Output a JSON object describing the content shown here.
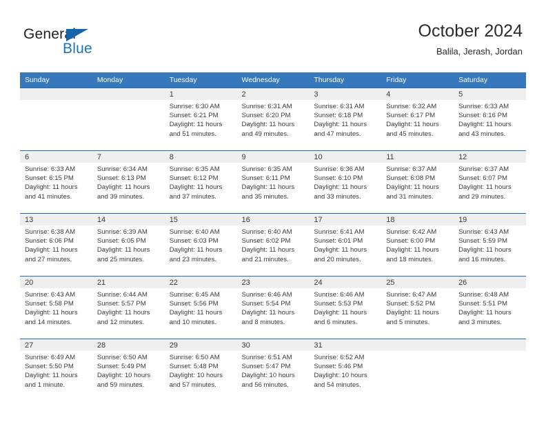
{
  "logo": {
    "word_one": "General",
    "word_two": "Blue",
    "flag_icon": "triangle-flag-icon",
    "brand_blue": "#1a74bd"
  },
  "header": {
    "title": "October 2024",
    "subtitle": "Balila, Jerash, Jordan"
  },
  "theme": {
    "header_blue": "#3778bc",
    "rule_blue": "#1d6cb3",
    "daynum_band": "#efefef",
    "text": "#3a3a3a"
  },
  "calendar": {
    "weekdays": [
      "Sunday",
      "Monday",
      "Tuesday",
      "Wednesday",
      "Thursday",
      "Friday",
      "Saturday"
    ],
    "weeks": [
      [
        {
          "day": "",
          "sunrise": "",
          "sunset": "",
          "daylight_1": "",
          "daylight_2": ""
        },
        {
          "day": "",
          "sunrise": "",
          "sunset": "",
          "daylight_1": "",
          "daylight_2": ""
        },
        {
          "day": "1",
          "sunrise": "Sunrise: 6:30 AM",
          "sunset": "Sunset: 6:21 PM",
          "daylight_1": "Daylight: 11 hours",
          "daylight_2": "and 51 minutes."
        },
        {
          "day": "2",
          "sunrise": "Sunrise: 6:31 AM",
          "sunset": "Sunset: 6:20 PM",
          "daylight_1": "Daylight: 11 hours",
          "daylight_2": "and 49 minutes."
        },
        {
          "day": "3",
          "sunrise": "Sunrise: 6:31 AM",
          "sunset": "Sunset: 6:18 PM",
          "daylight_1": "Daylight: 11 hours",
          "daylight_2": "and 47 minutes."
        },
        {
          "day": "4",
          "sunrise": "Sunrise: 6:32 AM",
          "sunset": "Sunset: 6:17 PM",
          "daylight_1": "Daylight: 11 hours",
          "daylight_2": "and 45 minutes."
        },
        {
          "day": "5",
          "sunrise": "Sunrise: 6:33 AM",
          "sunset": "Sunset: 6:16 PM",
          "daylight_1": "Daylight: 11 hours",
          "daylight_2": "and 43 minutes."
        }
      ],
      [
        {
          "day": "6",
          "sunrise": "Sunrise: 6:33 AM",
          "sunset": "Sunset: 6:15 PM",
          "daylight_1": "Daylight: 11 hours",
          "daylight_2": "and 41 minutes."
        },
        {
          "day": "7",
          "sunrise": "Sunrise: 6:34 AM",
          "sunset": "Sunset: 6:13 PM",
          "daylight_1": "Daylight: 11 hours",
          "daylight_2": "and 39 minutes."
        },
        {
          "day": "8",
          "sunrise": "Sunrise: 6:35 AM",
          "sunset": "Sunset: 6:12 PM",
          "daylight_1": "Daylight: 11 hours",
          "daylight_2": "and 37 minutes."
        },
        {
          "day": "9",
          "sunrise": "Sunrise: 6:35 AM",
          "sunset": "Sunset: 6:11 PM",
          "daylight_1": "Daylight: 11 hours",
          "daylight_2": "and 35 minutes."
        },
        {
          "day": "10",
          "sunrise": "Sunrise: 6:36 AM",
          "sunset": "Sunset: 6:10 PM",
          "daylight_1": "Daylight: 11 hours",
          "daylight_2": "and 33 minutes."
        },
        {
          "day": "11",
          "sunrise": "Sunrise: 6:37 AM",
          "sunset": "Sunset: 6:08 PM",
          "daylight_1": "Daylight: 11 hours",
          "daylight_2": "and 31 minutes."
        },
        {
          "day": "12",
          "sunrise": "Sunrise: 6:37 AM",
          "sunset": "Sunset: 6:07 PM",
          "daylight_1": "Daylight: 11 hours",
          "daylight_2": "and 29 minutes."
        }
      ],
      [
        {
          "day": "13",
          "sunrise": "Sunrise: 6:38 AM",
          "sunset": "Sunset: 6:06 PM",
          "daylight_1": "Daylight: 11 hours",
          "daylight_2": "and 27 minutes."
        },
        {
          "day": "14",
          "sunrise": "Sunrise: 6:39 AM",
          "sunset": "Sunset: 6:05 PM",
          "daylight_1": "Daylight: 11 hours",
          "daylight_2": "and 25 minutes."
        },
        {
          "day": "15",
          "sunrise": "Sunrise: 6:40 AM",
          "sunset": "Sunset: 6:03 PM",
          "daylight_1": "Daylight: 11 hours",
          "daylight_2": "and 23 minutes."
        },
        {
          "day": "16",
          "sunrise": "Sunrise: 6:40 AM",
          "sunset": "Sunset: 6:02 PM",
          "daylight_1": "Daylight: 11 hours",
          "daylight_2": "and 21 minutes."
        },
        {
          "day": "17",
          "sunrise": "Sunrise: 6:41 AM",
          "sunset": "Sunset: 6:01 PM",
          "daylight_1": "Daylight: 11 hours",
          "daylight_2": "and 20 minutes."
        },
        {
          "day": "18",
          "sunrise": "Sunrise: 6:42 AM",
          "sunset": "Sunset: 6:00 PM",
          "daylight_1": "Daylight: 11 hours",
          "daylight_2": "and 18 minutes."
        },
        {
          "day": "19",
          "sunrise": "Sunrise: 6:43 AM",
          "sunset": "Sunset: 5:59 PM",
          "daylight_1": "Daylight: 11 hours",
          "daylight_2": "and 16 minutes."
        }
      ],
      [
        {
          "day": "20",
          "sunrise": "Sunrise: 6:43 AM",
          "sunset": "Sunset: 5:58 PM",
          "daylight_1": "Daylight: 11 hours",
          "daylight_2": "and 14 minutes."
        },
        {
          "day": "21",
          "sunrise": "Sunrise: 6:44 AM",
          "sunset": "Sunset: 5:57 PM",
          "daylight_1": "Daylight: 11 hours",
          "daylight_2": "and 12 minutes."
        },
        {
          "day": "22",
          "sunrise": "Sunrise: 6:45 AM",
          "sunset": "Sunset: 5:56 PM",
          "daylight_1": "Daylight: 11 hours",
          "daylight_2": "and 10 minutes."
        },
        {
          "day": "23",
          "sunrise": "Sunrise: 6:46 AM",
          "sunset": "Sunset: 5:54 PM",
          "daylight_1": "Daylight: 11 hours",
          "daylight_2": "and 8 minutes."
        },
        {
          "day": "24",
          "sunrise": "Sunrise: 6:46 AM",
          "sunset": "Sunset: 5:53 PM",
          "daylight_1": "Daylight: 11 hours",
          "daylight_2": "and 6 minutes."
        },
        {
          "day": "25",
          "sunrise": "Sunrise: 6:47 AM",
          "sunset": "Sunset: 5:52 PM",
          "daylight_1": "Daylight: 11 hours",
          "daylight_2": "and 5 minutes."
        },
        {
          "day": "26",
          "sunrise": "Sunrise: 6:48 AM",
          "sunset": "Sunset: 5:51 PM",
          "daylight_1": "Daylight: 11 hours",
          "daylight_2": "and 3 minutes."
        }
      ],
      [
        {
          "day": "27",
          "sunrise": "Sunrise: 6:49 AM",
          "sunset": "Sunset: 5:50 PM",
          "daylight_1": "Daylight: 11 hours",
          "daylight_2": "and 1 minute."
        },
        {
          "day": "28",
          "sunrise": "Sunrise: 6:50 AM",
          "sunset": "Sunset: 5:49 PM",
          "daylight_1": "Daylight: 10 hours",
          "daylight_2": "and 59 minutes."
        },
        {
          "day": "29",
          "sunrise": "Sunrise: 6:50 AM",
          "sunset": "Sunset: 5:48 PM",
          "daylight_1": "Daylight: 10 hours",
          "daylight_2": "and 57 minutes."
        },
        {
          "day": "30",
          "sunrise": "Sunrise: 6:51 AM",
          "sunset": "Sunset: 5:47 PM",
          "daylight_1": "Daylight: 10 hours",
          "daylight_2": "and 56 minutes."
        },
        {
          "day": "31",
          "sunrise": "Sunrise: 6:52 AM",
          "sunset": "Sunset: 5:46 PM",
          "daylight_1": "Daylight: 10 hours",
          "daylight_2": "and 54 minutes."
        },
        {
          "day": "",
          "sunrise": "",
          "sunset": "",
          "daylight_1": "",
          "daylight_2": ""
        },
        {
          "day": "",
          "sunrise": "",
          "sunset": "",
          "daylight_1": "",
          "daylight_2": ""
        }
      ]
    ]
  }
}
